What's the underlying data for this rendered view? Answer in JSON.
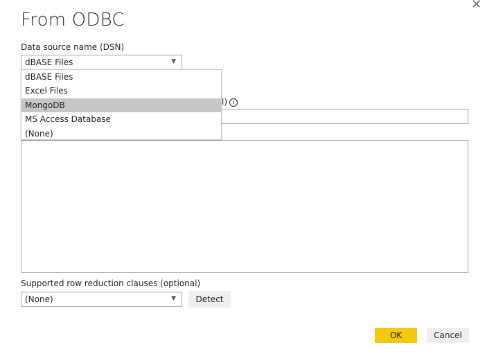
{
  "dialog": {
    "title": "From ODBC",
    "close_glyph": "✕"
  },
  "dsn": {
    "label": "Data source name (DSN)",
    "selected": "dBASE Files",
    "options": [
      "dBASE Files",
      "Excel Files",
      "MongoDB",
      "MS Access Database",
      "(None)"
    ],
    "highlighted": "MongoDB"
  },
  "hidden_label_fragment": "l)",
  "row_reduction": {
    "label": "Supported row reduction clauses (optional)",
    "selected": "(None)",
    "detect_label": "Detect"
  },
  "footer": {
    "ok_label": "OK",
    "cancel_label": "Cancel"
  },
  "colors": {
    "accent": "#f2c811",
    "highlight": "#c8c6c4"
  },
  "icons": {
    "chevron": "chevron-down-icon",
    "info": "info-icon",
    "close": "close-icon"
  }
}
